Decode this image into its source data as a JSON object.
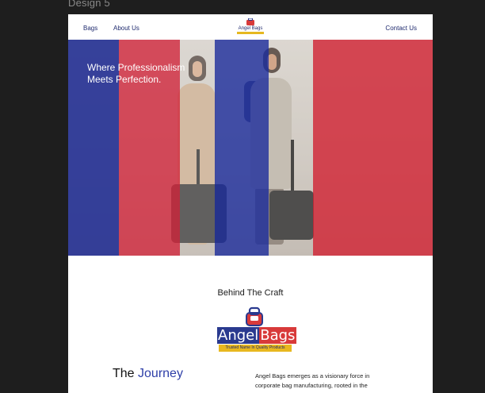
{
  "frame": {
    "label": "Design 5"
  },
  "nav": {
    "links": [
      "Bags",
      "About Us"
    ],
    "contact": "Contact Us",
    "logo_text": "Angel Bags"
  },
  "hero": {
    "headline_line1": "Where Professionalism",
    "headline_line2": "Meets Perfection."
  },
  "section": {
    "title": "Behind The Craft"
  },
  "brand": {
    "name_part1": "Angel",
    "name_part2": "Bags",
    "tagline": "Trusted Name In Quality Products"
  },
  "journey": {
    "title_part1": "The",
    "title_part2": "Journey",
    "text": "Angel Bags emerges as a visionary force in corporate bag manufacturing, rooted in the"
  },
  "colors": {
    "navy": "#2a3a8f",
    "red": "#d83a3a",
    "gold": "#e8b81f",
    "canvas": "#1e1e1e"
  }
}
